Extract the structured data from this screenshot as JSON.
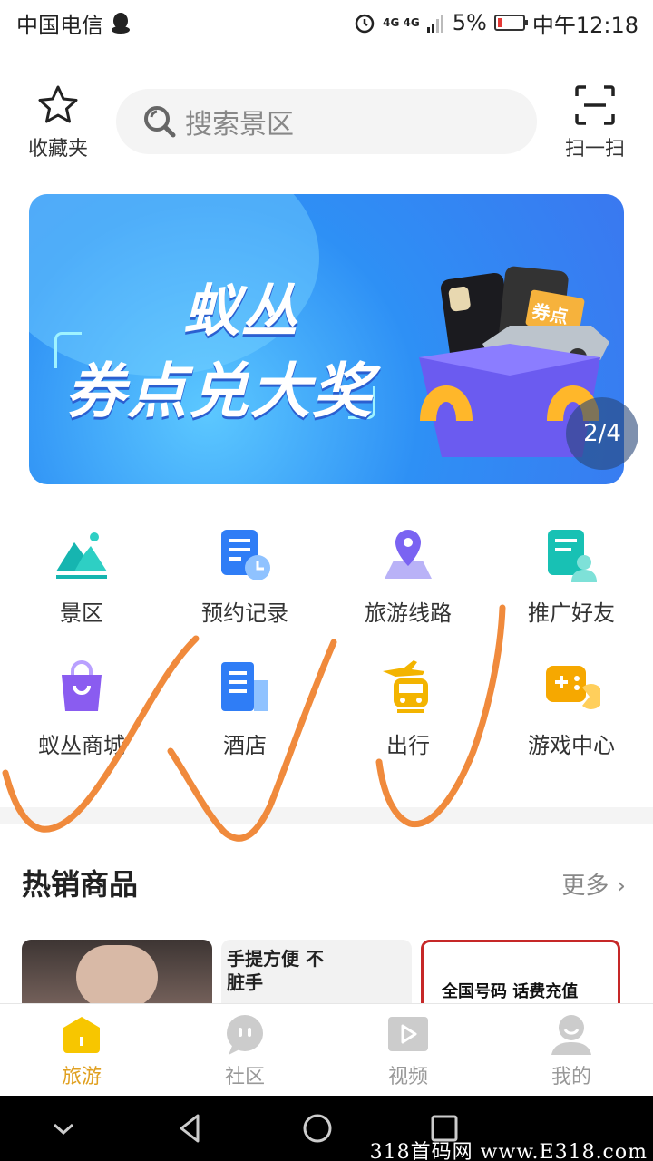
{
  "status_bar": {
    "carrier": "中国电信",
    "network": "4G 4G",
    "battery": "5%",
    "time": "中午12:18"
  },
  "header": {
    "favorites": "收藏夹",
    "search_placeholder": "搜索景区",
    "scan": "扫一扫"
  },
  "banner": {
    "title_line1": "蚁丛",
    "title_line2": "券点兑大奖",
    "badge": "券点",
    "pager": "2/4"
  },
  "grid": {
    "row1": [
      {
        "label": "景区",
        "icon": "mountain-icon"
      },
      {
        "label": "预约记录",
        "icon": "booking-record-icon"
      },
      {
        "label": "旅游线路",
        "icon": "map-pin-icon"
      },
      {
        "label": "推广好友",
        "icon": "invite-friend-icon"
      }
    ],
    "row2": [
      {
        "label": "蚁丛商城",
        "icon": "shopping-bag-icon"
      },
      {
        "label": "酒店",
        "icon": "hotel-icon"
      },
      {
        "label": "出行",
        "icon": "transport-icon"
      },
      {
        "label": "游戏中心",
        "icon": "game-icon"
      }
    ]
  },
  "hot": {
    "title": "热销商品",
    "more": "更多",
    "products": [
      {
        "caption": ""
      },
      {
        "caption": "手提方便 不脏手"
      },
      {
        "caption": "全国号码 话费充值"
      }
    ]
  },
  "tabs": [
    {
      "label": "旅游",
      "active": true
    },
    {
      "label": "社区",
      "active": false
    },
    {
      "label": "视频",
      "active": false
    },
    {
      "label": "我的",
      "active": false
    }
  ],
  "watermark": "318首码网 www.E318.com",
  "colors": {
    "accent": "#f0b400",
    "banner": "#3a8df5",
    "scribble": "#f08a3c"
  }
}
